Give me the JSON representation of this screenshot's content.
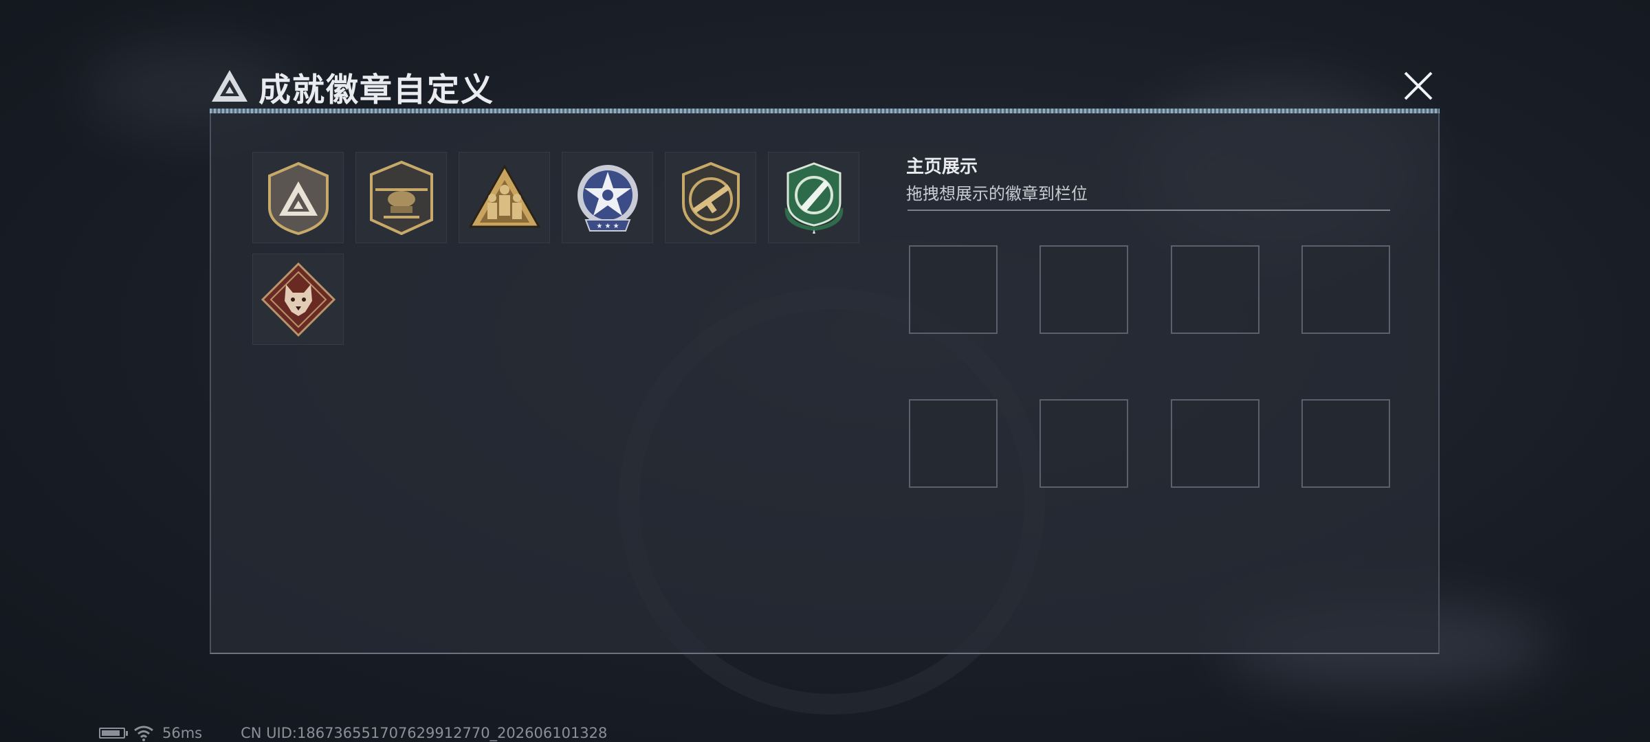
{
  "window": {
    "title": "成就徽章自定义"
  },
  "close_icon": "close-icon",
  "badges": [
    {
      "name": "triangle-shield-badge",
      "colors": [
        "#4a4a4a",
        "#c7a96a"
      ]
    },
    {
      "name": "helicopter-shield-badge",
      "colors": [
        "#3a3a3a",
        "#c7a96a"
      ]
    },
    {
      "name": "soldiers-triangle-badge",
      "colors": [
        "#b08a4a",
        "#6a4f2a"
      ]
    },
    {
      "name": "star-medal-badge",
      "colors": [
        "#3b4c86",
        "#d9dbe3"
      ]
    },
    {
      "name": "rifle-shield-badge",
      "colors": [
        "#2f2f2f",
        "#c7a96a"
      ]
    },
    {
      "name": "green-knife-badge",
      "colors": [
        "#2e6b4a",
        "#d8e6d8"
      ]
    },
    {
      "name": "wolf-diamond-badge",
      "colors": [
        "#6a2a24",
        "#d9b79a"
      ]
    }
  ],
  "display": {
    "title": "主页展示",
    "subtitle": "拖拽想展示的徽章到栏位",
    "slot_count": 8
  },
  "status_bar": {
    "ping": "56ms",
    "uid": "CN UID:1867365517076299127​70_202606101328",
    "battery_level": 0.85
  }
}
